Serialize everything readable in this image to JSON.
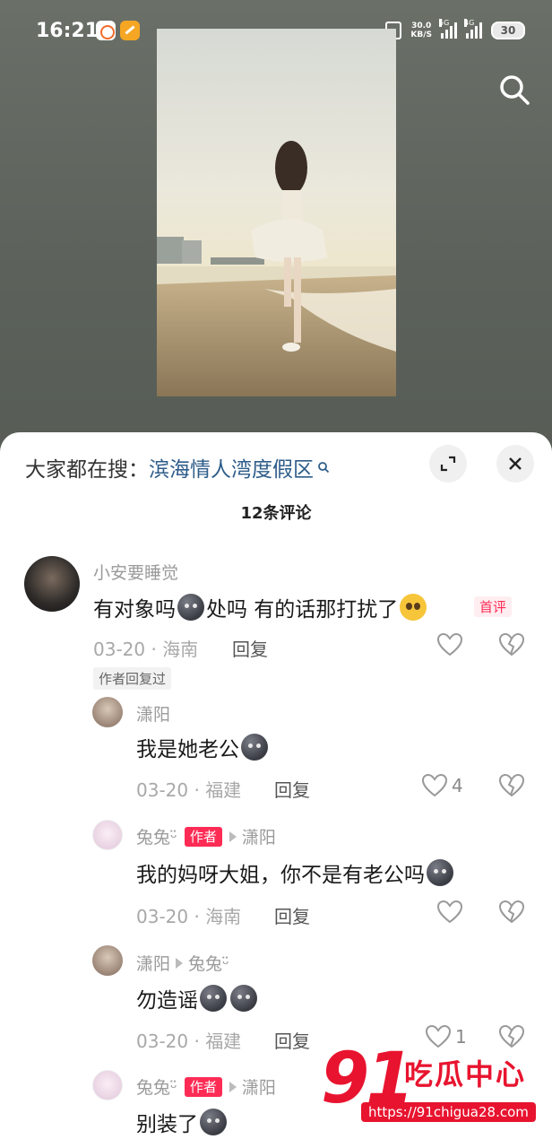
{
  "status_bar": {
    "time": "16:21",
    "net_speed_value": "30.0",
    "net_speed_unit": "KB/S",
    "signal1_label": "5G",
    "signal2_label": "4G",
    "battery": "30"
  },
  "comment_panel": {
    "search_prefix": "大家都在搜：",
    "search_term": "滨海情人湾度假区",
    "comment_count": "12条评论"
  },
  "comments": [
    {
      "username": "小安要睡觉",
      "text_part1": "有对象吗",
      "text_part2": " 处吗 有的话那打扰了",
      "tag": "首评",
      "date_location": "03-20 · 海南",
      "reply_label": "回复",
      "author_replied": "作者回复过"
    }
  ],
  "replies": [
    {
      "username": "潇阳",
      "text": "我是她老公",
      "date_location": "03-20 · 福建",
      "reply_label": "回复",
      "like_count": "4"
    },
    {
      "username": "兔兔ᵕ̈",
      "author_tag": "作者",
      "reply_to": "潇阳",
      "text": "我的妈呀大姐，你不是有老公吗",
      "date_location": "03-20 · 海南",
      "reply_label": "回复"
    },
    {
      "username": "潇阳",
      "reply_to": "兔兔ᵕ̈",
      "text": "勿造谣",
      "date_location": "03-20 · 福建",
      "reply_label": "回复",
      "like_count": "1"
    },
    {
      "username": "兔兔ᵕ̈",
      "author_tag": "作者",
      "reply_to": "潇阳",
      "text": "别装了"
    }
  ],
  "watermark": {
    "number": "91",
    "title": "吃瓜中心",
    "url": "https://91chigua28.com"
  },
  "colors": {
    "accent_red": "#fe2c55",
    "link_blue": "#2e5d8a",
    "watermark_red": "#e8142f"
  }
}
